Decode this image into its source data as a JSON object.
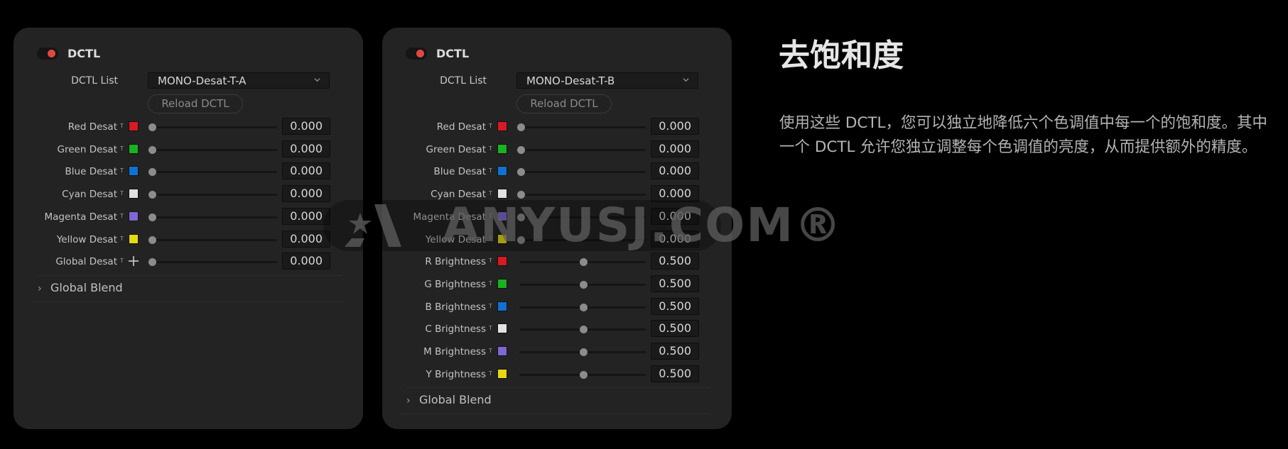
{
  "panels": [
    {
      "id": "panel-a",
      "title": "DCTL",
      "enabled": true,
      "list_label": "DCTL List",
      "dctl_selected": "MONO-Desat-T-A",
      "reload_label": "Reload DCTL",
      "params": [
        {
          "label": "Red Desat",
          "swatch": "#d81a24",
          "value": "0.000",
          "fraction": 0.0
        },
        {
          "label": "Green Desat",
          "swatch": "#1ab21f",
          "value": "0.000",
          "fraction": 0.0
        },
        {
          "label": "Blue Desat",
          "swatch": "#1171d3",
          "value": "0.000",
          "fraction": 0.0
        },
        {
          "label": "Cyan Desat",
          "swatch": "#e2e2e2",
          "value": "0.000",
          "fraction": 0.0
        },
        {
          "label": "Magenta Desat",
          "swatch": "#7f68d2",
          "value": "0.000",
          "fraction": 0.0
        },
        {
          "label": "Yellow Desat",
          "swatch": "#e8d812",
          "value": "0.000",
          "fraction": 0.0
        },
        {
          "label": "Global Desat",
          "swatch": "plus-icon",
          "value": "0.000",
          "fraction": 0.0
        }
      ],
      "section_label": "Global Blend"
    },
    {
      "id": "panel-b",
      "title": "DCTL",
      "enabled": true,
      "list_label": "DCTL List",
      "dctl_selected": "MONO-Desat-T-B",
      "reload_label": "Reload DCTL",
      "params": [
        {
          "label": "Red Desat",
          "swatch": "#d81a24",
          "value": "0.000",
          "fraction": 0.0
        },
        {
          "label": "Green Desat",
          "swatch": "#1ab21f",
          "value": "0.000",
          "fraction": 0.0
        },
        {
          "label": "Blue Desat",
          "swatch": "#1171d3",
          "value": "0.000",
          "fraction": 0.0
        },
        {
          "label": "Cyan Desat",
          "swatch": "#e2e2e2",
          "value": "0.000",
          "fraction": 0.0
        },
        {
          "label": "Magenta Desat",
          "swatch": "#7f68d2",
          "value": "0.000",
          "fraction": 0.0
        },
        {
          "label": "Yellow Desat",
          "swatch": "#e8d812",
          "value": "0.000",
          "fraction": 0.0
        },
        {
          "label": "R Brightness",
          "swatch": "#d81a24",
          "value": "0.500",
          "fraction": 0.5
        },
        {
          "label": "G Brightness",
          "swatch": "#1ab21f",
          "value": "0.500",
          "fraction": 0.5
        },
        {
          "label": "B Brightness",
          "swatch": "#1171d3",
          "value": "0.500",
          "fraction": 0.5
        },
        {
          "label": "C Brightness",
          "swatch": "#e2e2e2",
          "value": "0.500",
          "fraction": 0.5
        },
        {
          "label": "M Brightness",
          "swatch": "#7f68d2",
          "value": "0.500",
          "fraction": 0.5
        },
        {
          "label": "Y Brightness",
          "swatch": "#e8d812",
          "value": "0.500",
          "fraction": 0.5
        }
      ],
      "section_label": "Global Blend"
    }
  ],
  "param_mark": "T",
  "description": {
    "heading": "去饱和度",
    "paragraph": "使用这些 DCTL，您可以独立地降低六个色调值中每一个的饱和度。其中一个 DCTL 允许您独立调整每个色调值的亮度，从而提供额外的精度。"
  },
  "watermark": {
    "text": "ANYUSJ.COM®"
  },
  "colors": {
    "toggle_on": "#e0483f",
    "panel_bg": "#232323",
    "page_bg": "#000000"
  }
}
